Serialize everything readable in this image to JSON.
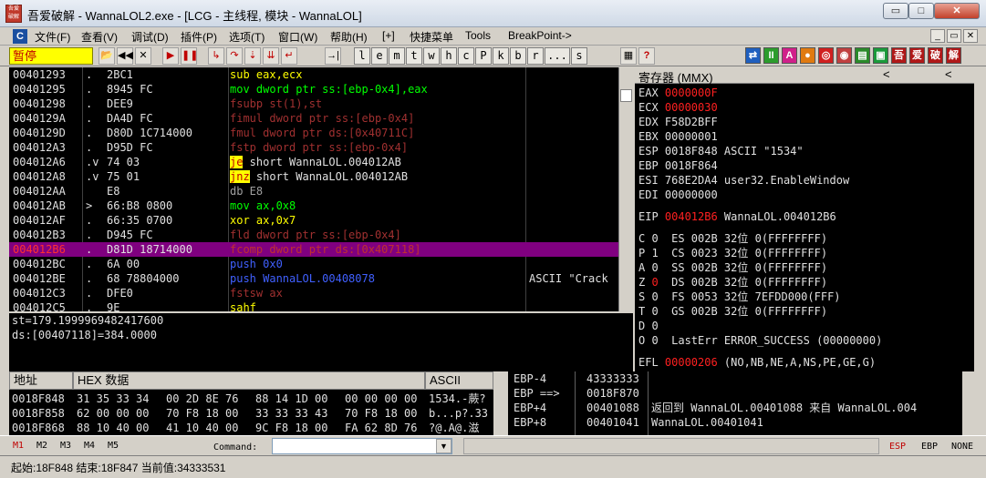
{
  "window": {
    "icon_text": "吾爱破解",
    "title": "吾爱破解 - WannaLOL2.exe - [LCG - 主线程, 模块 - WannaLOL]",
    "min_glyph": "▭",
    "max_glyph": "□",
    "close_glyph": "✕"
  },
  "menu": {
    "icon": "C",
    "items": [
      "文件(F)",
      "查看(V)",
      "调试(D)",
      "插件(P)",
      "选项(T)",
      "窗口(W)",
      "帮助(H)",
      "[+]",
      "快捷菜单",
      "Tools",
      "BreakPoint->"
    ],
    "mdi_buttons": [
      "_",
      "▭",
      "✕"
    ]
  },
  "toolbar": {
    "status": "暂停",
    "buttons": [
      "open",
      "restart",
      "close",
      "run",
      "pause",
      "step-into",
      "step-over",
      "trace-into",
      "trace-over",
      "execute-till-return",
      "go-to"
    ],
    "button_glyphs": [
      "📂",
      "◀◀",
      "✕",
      "▶",
      "❚❚",
      "↳",
      "↷",
      "⇣",
      "⇊",
      "↵",
      "→|"
    ],
    "letters": [
      "l",
      "e",
      "m",
      "t",
      "w",
      "h",
      "c",
      "P",
      "k",
      "b",
      "r",
      "...",
      "s"
    ],
    "extra_glyphs": [
      "▦",
      "?"
    ],
    "right_buttons": [
      "⇄",
      "II",
      "A",
      "●",
      "◎",
      "◉",
      "▤",
      "▣",
      "吾",
      "爱",
      "破",
      "解"
    ],
    "right_colors": [
      "#1f5fbf",
      "#2c9c2c",
      "#d0208a",
      "#e07a10",
      "#d02020",
      "#c04040",
      "#2a8a2a",
      "#1a9a3a",
      "#b01818",
      "#b01818",
      "#b01818",
      "#b01818"
    ]
  },
  "disasm": {
    "rows": [
      {
        "addr": "00401293",
        "arrow": ".",
        "hex": "2BC1",
        "asm": "sub eax,ecx",
        "color": "#ffff00",
        "cmt": ""
      },
      {
        "addr": "00401295",
        "arrow": ".",
        "hex": "8945 FC",
        "asm": "mov dword ptr ss:[ebp-0x4],eax",
        "color": "#00ff00",
        "cmt": ""
      },
      {
        "addr": "00401298",
        "arrow": ".",
        "hex": "DEE9",
        "asm": "fsubp st(1),st",
        "color": "#a03030",
        "cmt": ""
      },
      {
        "addr": "0040129A",
        "arrow": ".",
        "hex": "DA4D FC",
        "asm": "fimul dword ptr ss:[ebp-0x4]",
        "color": "#a03030",
        "cmt": ""
      },
      {
        "addr": "0040129D",
        "arrow": ".",
        "hex": "D80D 1C714000",
        "asm": "fmul dword ptr ds:[0x40711C]",
        "color": "#a03030",
        "cmt": ""
      },
      {
        "addr": "004012A3",
        "arrow": ".",
        "hex": "D95D FC",
        "asm": "fstp dword ptr ss:[ebp-0x4]",
        "color": "#a03030",
        "cmt": ""
      },
      {
        "addr": "004012A6",
        "arrow": ".v",
        "hex": "74 03",
        "asm": "je short WannaLOL.004012AB",
        "color": "#e0e0e0",
        "cmt": "",
        "jmp": "je"
      },
      {
        "addr": "004012A8",
        "arrow": ".v",
        "hex": "75 01",
        "asm": "jnz short WannaLOL.004012AB",
        "color": "#e0e0e0",
        "cmt": "",
        "jmp": "jnz"
      },
      {
        "addr": "004012AA",
        "arrow": "",
        "hex": "E8",
        "asm": "db E8",
        "color": "#a0a0a0",
        "cmt": ""
      },
      {
        "addr": "004012AB",
        "arrow": ">",
        "hex": "66:B8 0800",
        "asm": "mov ax,0x8",
        "color": "#00ff00",
        "cmt": ""
      },
      {
        "addr": "004012AF",
        "arrow": ".",
        "hex": "66:35 0700",
        "asm": "xor ax,0x7",
        "color": "#ffff00",
        "cmt": ""
      },
      {
        "addr": "004012B3",
        "arrow": ".",
        "hex": "D945 FC",
        "asm": "fld dword ptr ss:[ebp-0x4]",
        "color": "#a03030",
        "cmt": ""
      },
      {
        "addr": "004012B6",
        "arrow": ".",
        "hex": "D81D 18714000",
        "asm": "fcomp dword ptr ds:[0x407118]",
        "color": "#c03030",
        "cmt": "",
        "selected": true
      },
      {
        "addr": "004012BC",
        "arrow": ".",
        "hex": "6A 00",
        "asm": "push 0x0",
        "color": "#4060ff",
        "cmt": ""
      },
      {
        "addr": "004012BE",
        "arrow": ".",
        "hex": "68 78804000",
        "asm": "push WannaLOL.00408078",
        "color": "#4060ff",
        "cmt": "ASCII \"Crack"
      },
      {
        "addr": "004012C3",
        "arrow": ".",
        "hex": "DFE0",
        "asm": "fstsw ax",
        "color": "#a03030",
        "cmt": ""
      },
      {
        "addr": "004012C5",
        "arrow": ".",
        "hex": "9E",
        "asm": "sahf",
        "color": "#ffff00",
        "cmt": ""
      }
    ]
  },
  "info": {
    "line1": "st=179.1999969482421875 00",
    "line1_display": "st=179.1999969482417600",
    "line2": "ds:[00407118]=384.0000"
  },
  "registers": {
    "title": "寄存器 (MMX)",
    "nav_left": "<",
    "nav_right": "<",
    "lines": [
      {
        "name": "EAX",
        "value": "0000000F",
        "rest": "",
        "red": true
      },
      {
        "name": "ECX",
        "value": "00000030",
        "rest": "",
        "red": true
      },
      {
        "name": "EDX",
        "value": "F58D2BFF",
        "rest": "",
        "red": false
      },
      {
        "name": "EBX",
        "value": "00000001",
        "rest": "",
        "red": false
      },
      {
        "name": "ESP",
        "value": "0018F848",
        "rest": "ASCII \"1534\"",
        "red": false
      },
      {
        "name": "EBP",
        "value": "0018F864",
        "rest": "",
        "red": false
      },
      {
        "name": "ESI",
        "value": "768E2DA4",
        "rest": "user32.EnableWindow",
        "red": false
      },
      {
        "name": "EDI",
        "value": "00000000",
        "rest": "",
        "red": false
      }
    ],
    "eip": {
      "name": "EIP",
      "value": "004012B6",
      "rest": "WannaLOL.004012B6"
    },
    "flags": [
      {
        "f": "C",
        "v": "0",
        "seg": "ES",
        "sel": "002B",
        "bits": "32位",
        "base": "0(FFFFFFFF)",
        "red": false
      },
      {
        "f": "P",
        "v": "1",
        "seg": "CS",
        "sel": "0023",
        "bits": "32位",
        "base": "0(FFFFFFFF)",
        "red": false
      },
      {
        "f": "A",
        "v": "0",
        "seg": "SS",
        "sel": "002B",
        "bits": "32位",
        "base": "0(FFFFFFFF)",
        "red": false
      },
      {
        "f": "Z",
        "v": "0",
        "seg": "DS",
        "sel": "002B",
        "bits": "32位",
        "base": "0(FFFFFFFF)",
        "red": true
      },
      {
        "f": "S",
        "v": "0",
        "seg": "FS",
        "sel": "0053",
        "bits": "32位",
        "base": "7EFDD000(FFF)",
        "red": false
      },
      {
        "f": "T",
        "v": "0",
        "seg": "GS",
        "sel": "002B",
        "bits": "32位",
        "base": "0(FFFFFFFF)",
        "red": false
      },
      {
        "f": "D",
        "v": "0",
        "seg": "",
        "sel": "",
        "bits": "",
        "base": "",
        "red": false
      },
      {
        "f": "O",
        "v": "0",
        "seg": "LastErr",
        "sel": "",
        "bits": "",
        "base": "ERROR_SUCCESS (00000000)",
        "red": false
      }
    ],
    "efl": {
      "name": "EFL",
      "value": "00000206",
      "rest": "(NO,NB,NE,A,NS,PE,GE,G)"
    }
  },
  "dump": {
    "col_addr": "地址",
    "col_hex": "HEX 数据",
    "col_ascii": "ASCII",
    "rows": [
      {
        "addr": "0018F848",
        "hex1": "31 35 33 34",
        "hex2": "00 2D 8E 76",
        "hex3": "88 14 1D 00",
        "hex4": "00 00 00 00",
        "ascii": "1534.-蕨?"
      },
      {
        "addr": "0018F858",
        "hex1": "62 00 00 00",
        "hex2": "70 F8 18 00",
        "hex3": "33 33 33 43",
        "hex4": "70 F8 18 00",
        "ascii": "b...p?.33"
      },
      {
        "addr": "0018F868",
        "hex1": "88 10 40 00",
        "hex2": "41 10 40 00",
        "hex3": "9C F8 18 00",
        "hex4": "FA 62 8D 76",
        "ascii": "?@.A@.滋"
      }
    ]
  },
  "stack": {
    "rows": [
      {
        "label": "EBP-4",
        "value": "43333333",
        "comment": ""
      },
      {
        "label": "EBP ==>",
        "value": "0018F870",
        "comment": ""
      },
      {
        "label": "EBP+4",
        "value": "00401088",
        "comment": "返回到 WannaLOL.00401088 来自 WannaLOL.004"
      },
      {
        "label": "EBP+8",
        "value": "00401041",
        "comment": "WannaLOL.00401041"
      }
    ]
  },
  "command": {
    "tabs": [
      "M1",
      "M2",
      "M3",
      "M4",
      "M5"
    ],
    "label": "Command:",
    "value": "",
    "reg_tabs": [
      "ESP",
      "EBP",
      "NONE"
    ]
  },
  "status": {
    "text": "起始:18F848 结束:18F847 当前值:34333531"
  },
  "colors": {
    "selected_row": "#800080",
    "highlight_jump": "#ffff00",
    "modified_register": "#ff2020"
  }
}
